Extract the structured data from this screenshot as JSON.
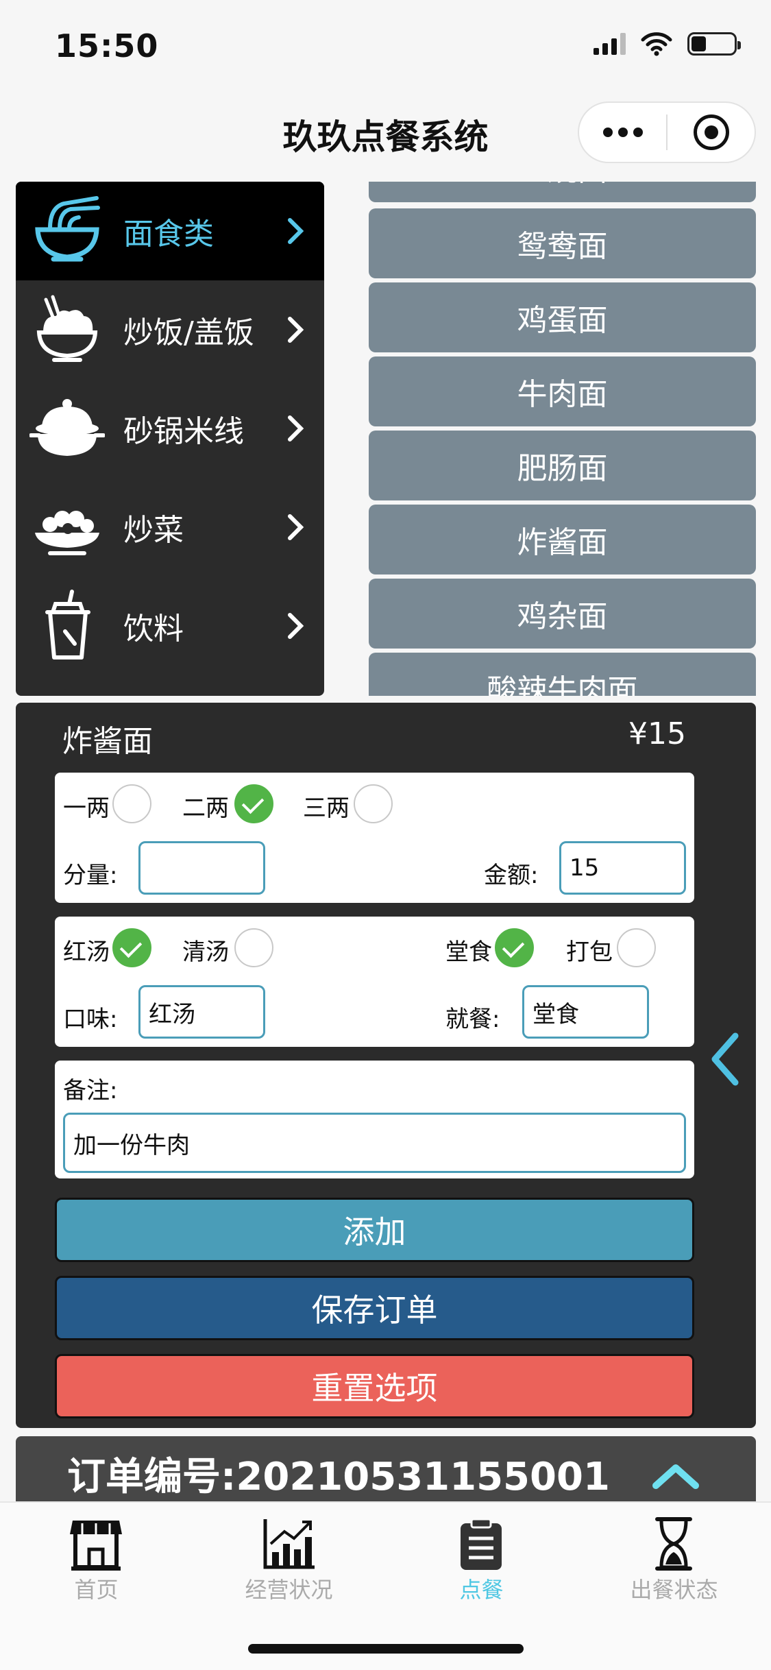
{
  "status_bar": {
    "time": "15:50"
  },
  "nav": {
    "title": "玖玖点餐系统"
  },
  "categories": [
    {
      "label": "面食类",
      "icon": "noodle-bowl-icon",
      "active": true
    },
    {
      "label": "炒饭/盖饭",
      "icon": "rice-bowl-icon",
      "active": false
    },
    {
      "label": "砂锅米线",
      "icon": "clay-pot-icon",
      "active": false
    },
    {
      "label": "炒菜",
      "icon": "stir-fry-plate-icon",
      "active": false
    },
    {
      "label": "饮料",
      "icon": "drink-cup-icon",
      "active": false
    }
  ],
  "dishes": [
    {
      "label": "红烧面"
    },
    {
      "label": "鸳鸯面"
    },
    {
      "label": "鸡蛋面"
    },
    {
      "label": "牛肉面"
    },
    {
      "label": "肥肠面"
    },
    {
      "label": "炸酱面"
    },
    {
      "label": "鸡杂面"
    },
    {
      "label": "酸辣牛肉面"
    }
  ],
  "order_form": {
    "dish_name": "炸酱面",
    "price": "¥15",
    "portions": [
      {
        "label": "一两",
        "checked": false
      },
      {
        "label": "二两",
        "checked": true
      },
      {
        "label": "三两",
        "checked": false
      }
    ],
    "portion_label": "分量:",
    "portion_value": "",
    "amount_label": "金额:",
    "amount_value": "15",
    "soups": [
      {
        "label": "红汤",
        "checked": true
      },
      {
        "label": "清汤",
        "checked": false
      }
    ],
    "dining": [
      {
        "label": "堂食",
        "checked": true
      },
      {
        "label": "打包",
        "checked": false
      }
    ],
    "taste_label": "口味:",
    "taste_value": "红汤",
    "dine_label": "就餐:",
    "dine_value": "堂食",
    "note_label": "备注:",
    "note_value": "加一份牛肉",
    "add_label": "添加",
    "save_label": "保存订单",
    "reset_label": "重置选项"
  },
  "order_bar": {
    "label": "订单编号:",
    "number": "20210531155001"
  },
  "tabs": [
    {
      "label": "首页",
      "icon": "storefront-icon",
      "active": false
    },
    {
      "label": "经营状况",
      "icon": "bar-chart-icon",
      "active": false
    },
    {
      "label": "点餐",
      "icon": "clipboard-icon",
      "active": true
    },
    {
      "label": "出餐状态",
      "icon": "hourglass-icon",
      "active": false
    }
  ],
  "colors": {
    "accent": "#58c7ea",
    "dish_button": "#798994",
    "add_button": "#4a9db8",
    "save_button": "#265b8b",
    "reset_button": "#eb625a",
    "check_green": "#52b447"
  }
}
